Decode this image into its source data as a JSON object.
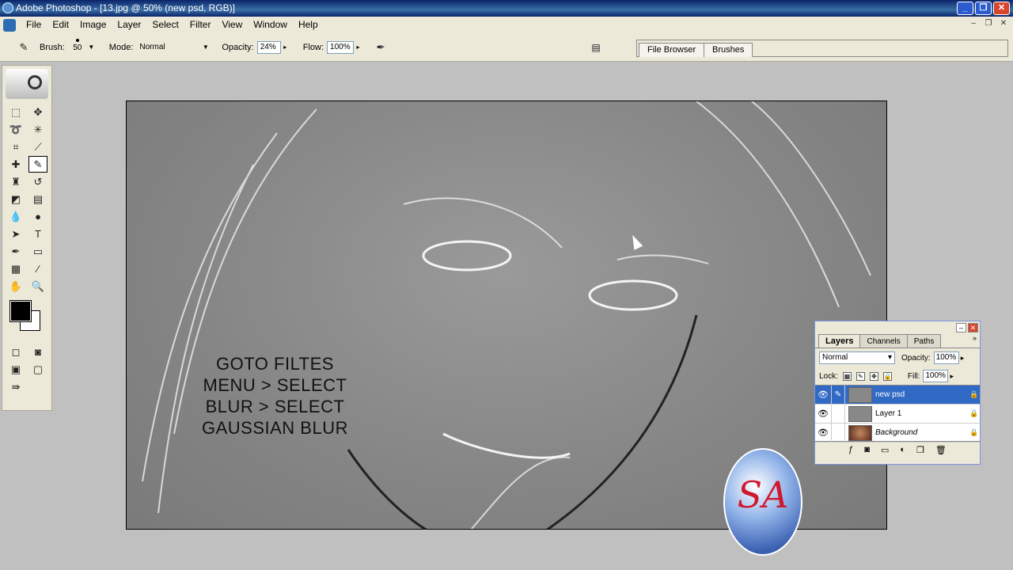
{
  "window": {
    "title": "Adobe Photoshop - [13.jpg @ 50% (new psd, RGB)]"
  },
  "menu": [
    "File",
    "Edit",
    "Image",
    "Layer",
    "Select",
    "Filter",
    "View",
    "Window",
    "Help"
  ],
  "options": {
    "brush_label": "Brush:",
    "brush_size": "50",
    "mode_label": "Mode:",
    "mode_value": "Normal",
    "opacity_label": "Opacity:",
    "opacity_value": "24%",
    "flow_label": "Flow:",
    "flow_value": "100%"
  },
  "palette_well": {
    "tabs": [
      "File Browser",
      "Brushes"
    ]
  },
  "canvas": {
    "overlay_lines": [
      "GOTO FILTES",
      "MENU > SELECT",
      "BLUR > SELECT",
      "GAUSSIAN BLUR"
    ]
  },
  "layers_panel": {
    "tabs": [
      "Layers",
      "Channels",
      "Paths"
    ],
    "blend_mode": "Normal",
    "opacity_label": "Opacity:",
    "opacity_value": "100%",
    "lock_label": "Lock:",
    "fill_label": "Fill:",
    "fill_value": "100%",
    "layers": [
      {
        "name": "new psd",
        "active": true
      },
      {
        "name": "Layer 1",
        "active": false
      },
      {
        "name": "Background",
        "active": false
      }
    ]
  },
  "colors": {
    "accent": "#316ac5",
    "titlebar": "#0a246a",
    "foreground": "#000000",
    "background": "#ffffff"
  }
}
